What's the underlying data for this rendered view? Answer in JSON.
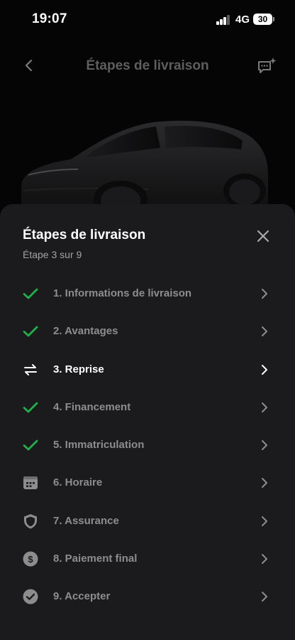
{
  "status_bar": {
    "time": "19:07",
    "network": "4G",
    "battery": "30"
  },
  "header": {
    "title": "Étapes de livraison"
  },
  "sheet": {
    "title": "Étapes de livraison",
    "subtitle": "Étape 3 sur 9",
    "steps": [
      {
        "label": "1. Informations de livraison",
        "icon": "check-icon",
        "state": "done"
      },
      {
        "label": "2. Avantages",
        "icon": "check-icon",
        "state": "done"
      },
      {
        "label": "3. Reprise",
        "icon": "swap-arrows-icon",
        "state": "current"
      },
      {
        "label": "4. Financement",
        "icon": "check-icon",
        "state": "done"
      },
      {
        "label": "5. Immatriculation",
        "icon": "check-icon",
        "state": "done"
      },
      {
        "label": "6. Horaire",
        "icon": "calendar-icon",
        "state": "todo"
      },
      {
        "label": "7. Assurance",
        "icon": "shield-icon",
        "state": "todo"
      },
      {
        "label": "8. Paiement final",
        "icon": "dollar-icon",
        "state": "todo"
      },
      {
        "label": "9. Accepter",
        "icon": "check-circle-icon",
        "state": "todo"
      }
    ]
  },
  "colors": {
    "check": "#1fb24a",
    "muted": "#8d8d8d",
    "sheet_bg": "#1b1b1d"
  }
}
